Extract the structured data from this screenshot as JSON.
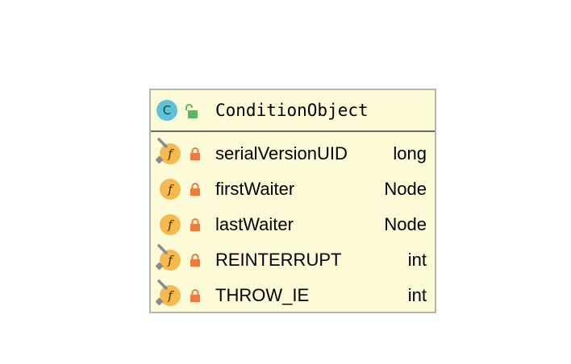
{
  "class": {
    "icon_letter": "C",
    "icon": "class-icon",
    "visibility_icon": "open-lock-icon",
    "name": "ConditionObject"
  },
  "fields": [
    {
      "name": "serialVersionUID",
      "type": "long",
      "icon_letter": "f",
      "static": true,
      "visibility_icon": "private-lock-icon"
    },
    {
      "name": "firstWaiter",
      "type": "Node",
      "icon_letter": "f",
      "static": false,
      "visibility_icon": "private-lock-icon"
    },
    {
      "name": "lastWaiter",
      "type": "Node",
      "icon_letter": "f",
      "static": false,
      "visibility_icon": "private-lock-icon"
    },
    {
      "name": "REINTERRUPT",
      "type": "int",
      "icon_letter": "f",
      "static": true,
      "visibility_icon": "private-lock-icon"
    },
    {
      "name": "THROW_IE",
      "type": "int",
      "icon_letter": "f",
      "static": true,
      "visibility_icon": "private-lock-icon"
    }
  ],
  "colors": {
    "box_fill": "#fcfad7",
    "class_icon": "#5fc1d8",
    "field_icon": "#f6b94e",
    "private_lock": "#f07a3c",
    "open_lock": "#5cb85c"
  }
}
